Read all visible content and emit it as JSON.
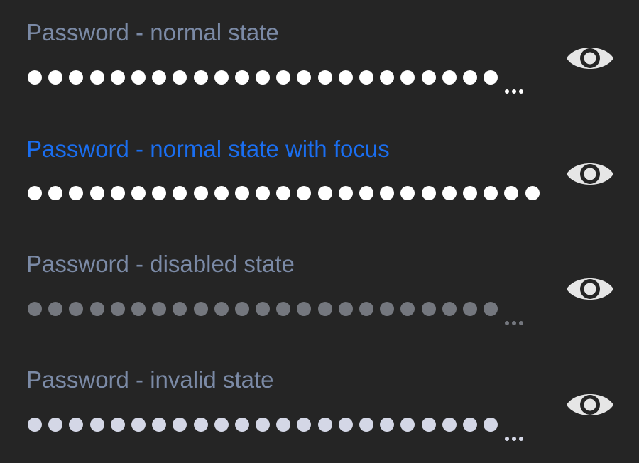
{
  "fields": [
    {
      "state": "normal",
      "label": "Password - normal state",
      "masked_dot_count": 23,
      "truncated": true,
      "toggle_icon": "eye-icon"
    },
    {
      "state": "focus",
      "label": "Password - normal state with focus",
      "masked_dot_count": 25,
      "truncated": false,
      "toggle_icon": "eye-icon"
    },
    {
      "state": "disabled",
      "label": "Password - disabled state",
      "masked_dot_count": 23,
      "truncated": true,
      "toggle_icon": "eye-icon"
    },
    {
      "state": "invalid",
      "label": "Password - invalid state",
      "masked_dot_count": 23,
      "truncated": true,
      "toggle_icon": "eye-icon"
    }
  ],
  "colors": {
    "background": "#252525",
    "label": "#7b8aa6",
    "label_focus": "#1a6ef0",
    "dot_normal": "#ffffff",
    "dot_disabled": "#74777e",
    "dot_invalid": "#d4d7e6",
    "eye_icon": "#e6e6e6"
  }
}
